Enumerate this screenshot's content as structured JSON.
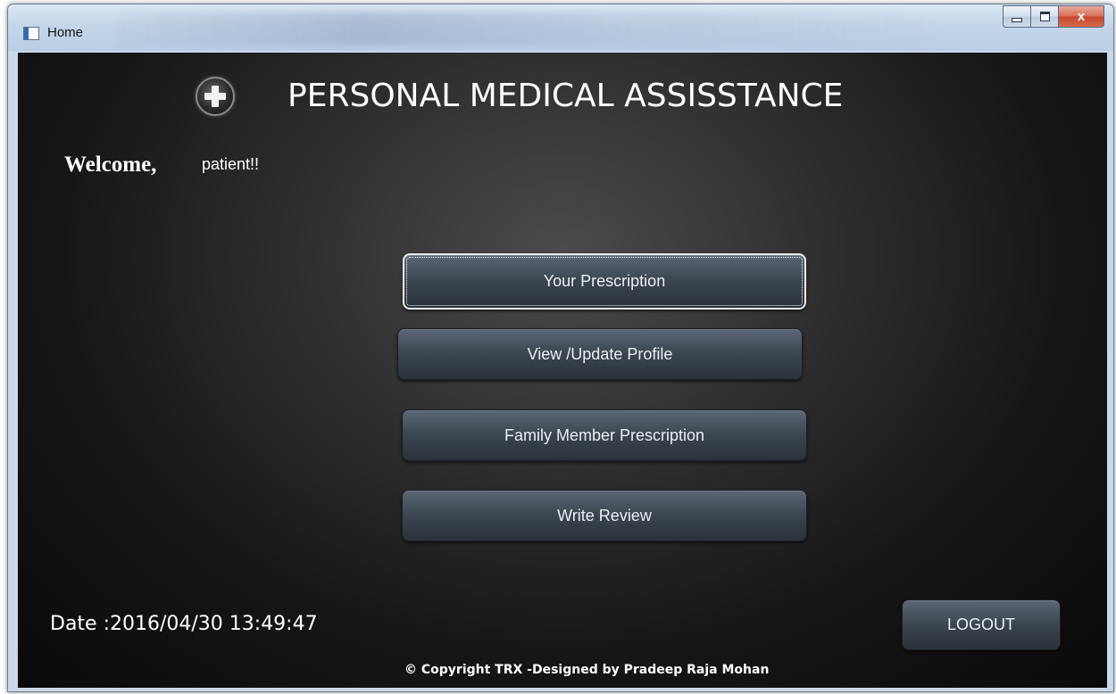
{
  "window": {
    "title": "Home",
    "controls": {
      "minimize_icon": "minimize-icon",
      "maximize_icon": "maximize-icon",
      "close_icon": "close-icon",
      "close_label": "x"
    }
  },
  "header": {
    "logo_icon": "medical-cross-icon",
    "app_title": "PERSONAL MEDICAL ASSISSTANCE"
  },
  "welcome": {
    "label": "Welcome,",
    "user": "patient!!"
  },
  "menu": {
    "items": [
      {
        "label": "Your Prescription",
        "focused": true
      },
      {
        "label": "View /Update Profile",
        "focused": false
      },
      {
        "label": "Family Member Prescription",
        "focused": false
      },
      {
        "label": "Write Review",
        "focused": false
      }
    ]
  },
  "footer": {
    "date": "Date :2016/04/30 13:49:47",
    "logout_label": "LOGOUT",
    "copyright": "© Copyright TRX -Designed by Pradeep Raja Mohan"
  },
  "colors": {
    "background": "#1e1e1e",
    "button_top": "#5b6775",
    "button_bottom": "#2a3139",
    "text": "#ffffff",
    "close_button": "#c7482f"
  }
}
